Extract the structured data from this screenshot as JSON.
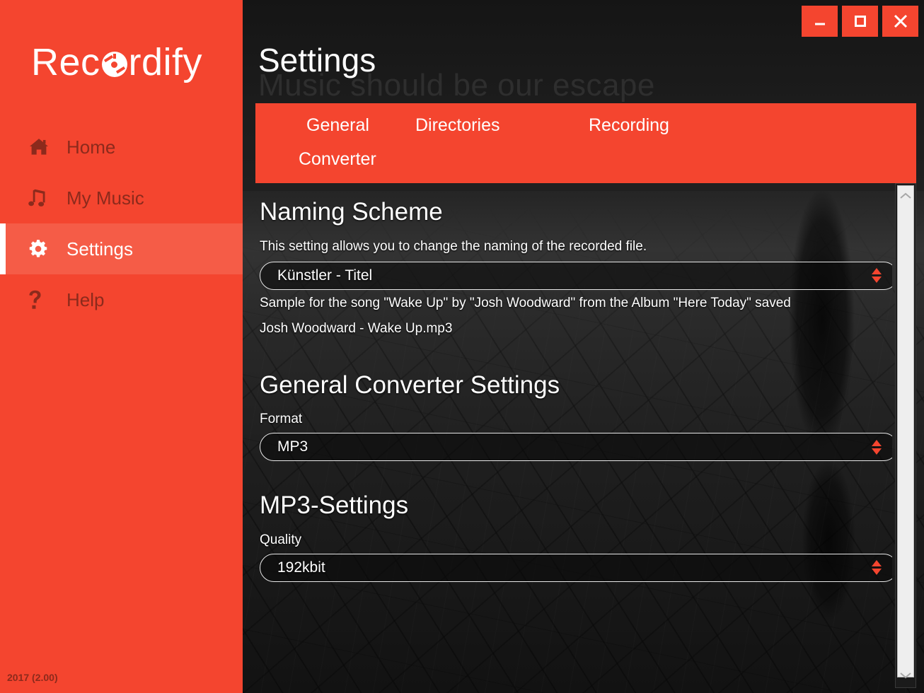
{
  "app": {
    "brand_before": "Rec",
    "brand_after": "rdify",
    "brand_full": "Recordify",
    "version": "2017 (2.00)"
  },
  "titlebar": {
    "minimize_label": "Minimize",
    "maximize_label": "Maximize",
    "close_label": "Close"
  },
  "sidebar": {
    "items": [
      {
        "label": "Home",
        "icon": "home-icon",
        "active": false
      },
      {
        "label": "My Music",
        "icon": "music-icon",
        "active": false
      },
      {
        "label": "Settings",
        "icon": "gear-icon",
        "active": true
      },
      {
        "label": "Help",
        "icon": "question-icon",
        "active": false
      }
    ]
  },
  "header": {
    "title": "Settings",
    "watermark": "Music should be our escape"
  },
  "tabs": [
    {
      "label": "General",
      "selected": false
    },
    {
      "label": "Directories",
      "selected": false
    },
    {
      "label": "Recording",
      "selected": false
    },
    {
      "label": "Converter",
      "selected": true
    }
  ],
  "sections": {
    "naming": {
      "heading": "Naming Scheme",
      "description": "This setting allows you to change the naming of the recorded file.",
      "scheme_value": "Künstler - Titel",
      "sample_intro": "Sample for the song \"Wake Up\" by \"Josh Woodward\" from the Album \"Here Today\" saved",
      "sample_result": "Josh Woodward - Wake Up.mp3"
    },
    "converter": {
      "heading": "General Converter Settings",
      "format_label": "Format",
      "format_value": "MP3"
    },
    "mp3": {
      "heading": "MP3-Settings",
      "quality_label": "Quality",
      "quality_value": "192kbit"
    }
  },
  "colors": {
    "accent": "#f4452f",
    "accent_active": "#f55c47",
    "sidebar_text": "#8c2a1c",
    "panel_dark": "#1c1c1c",
    "text_light": "#ffffff"
  },
  "scrollbar": {
    "up_icon": "chevron-up-icon",
    "down_icon": "chevron-down-icon"
  }
}
